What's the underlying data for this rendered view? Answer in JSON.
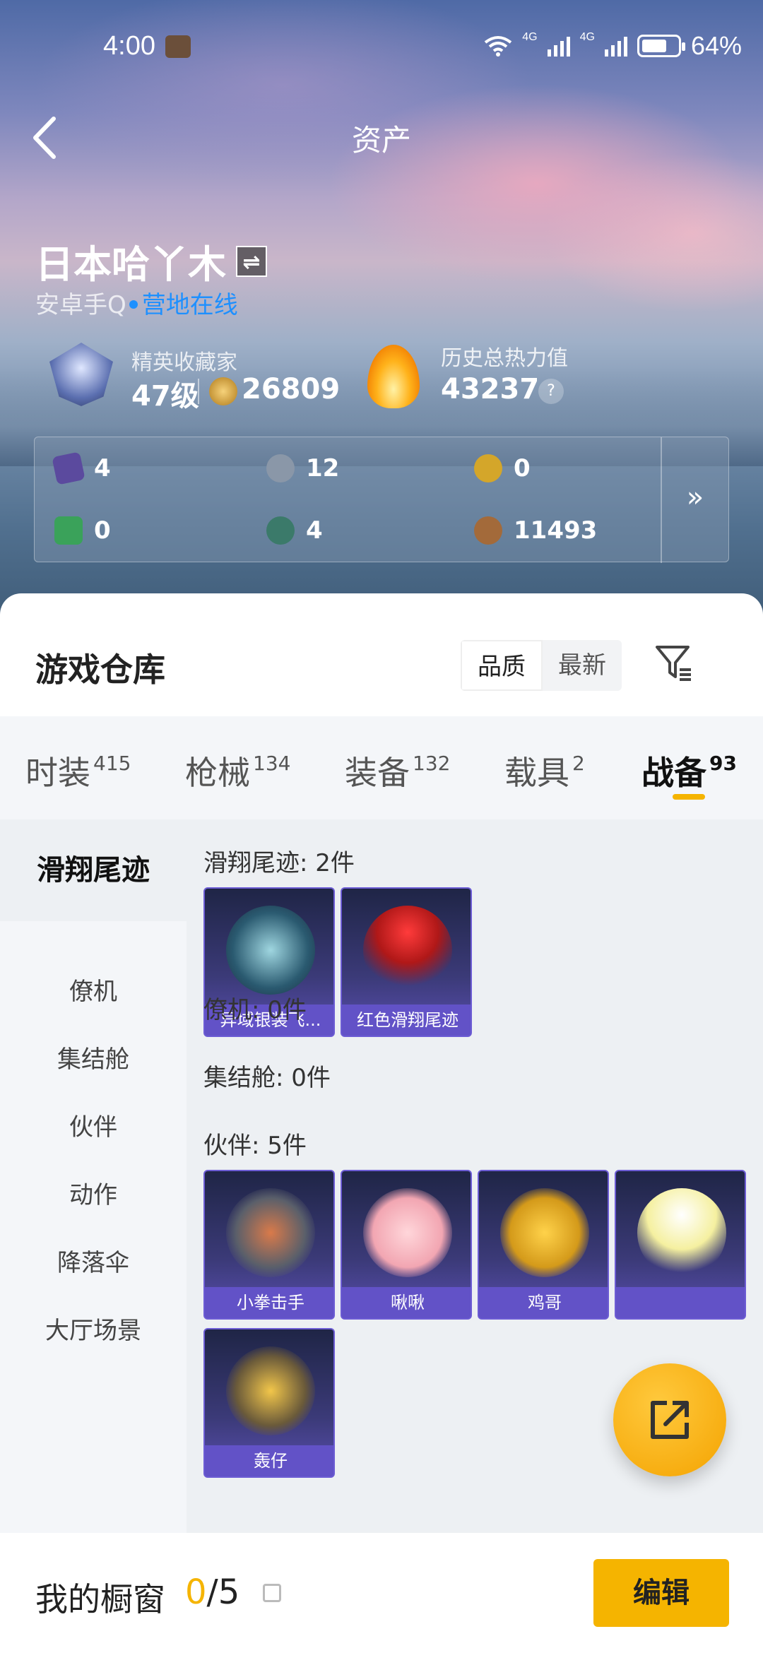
{
  "status": {
    "time": "4:00",
    "battery": "64%",
    "net1": "4G",
    "net2": "4G"
  },
  "header": {
    "title": "资产"
  },
  "profile": {
    "name": "日本哈丫木",
    "platform": "安卓手Q",
    "online": "营地在线",
    "rank_title": "精英收藏家",
    "level": "47级",
    "coins": "26809",
    "heat_title": "历史总热力值",
    "heat_value": "43237",
    "help": "?"
  },
  "stats": [
    {
      "value": "4",
      "icon": "purple-card-icon",
      "color": "#5b4a9e"
    },
    {
      "value": "12",
      "icon": "silver-coin-icon",
      "color": "#8a97a8"
    },
    {
      "value": "0",
      "icon": "gold-coin-icon",
      "color": "#d4a62a"
    },
    {
      "value": "0",
      "icon": "green-card-icon",
      "color": "#3aa25a"
    },
    {
      "value": "4",
      "icon": "green-orb-icon",
      "color": "#3b7a6a"
    },
    {
      "value": "11493",
      "icon": "bronze-coin-icon",
      "color": "#a36a3a"
    }
  ],
  "stats_more": "»",
  "warehouse": {
    "title": "游戏仓库",
    "sort": [
      "品质",
      "最新"
    ]
  },
  "tabs": [
    {
      "label": "时装",
      "count": "415"
    },
    {
      "label": "枪械",
      "count": "134"
    },
    {
      "label": "装备",
      "count": "132"
    },
    {
      "label": "载具",
      "count": "2"
    },
    {
      "label": "战备",
      "count": "93"
    }
  ],
  "sidebar": [
    "滑翔尾迹",
    "僚机",
    "集结舱",
    "伙伴",
    "动作",
    "降落伞",
    "大厅场景"
  ],
  "sections": {
    "glide": {
      "label": "滑翔尾迹: 2件",
      "items": [
        "异域银装飞...",
        "红色滑翔尾迹"
      ]
    },
    "wingman": {
      "label": "僚机: 0件"
    },
    "capsule": {
      "label": "集结舱: 0件"
    },
    "partner": {
      "label": "伙伴: 5件",
      "items": [
        "小拳击手",
        "啾啾",
        "鸡哥",
        "",
        "轰仔"
      ]
    }
  },
  "bottom": {
    "title": "我的橱窗",
    "count_current": "0",
    "count_total": "/5",
    "edit": "编辑"
  }
}
